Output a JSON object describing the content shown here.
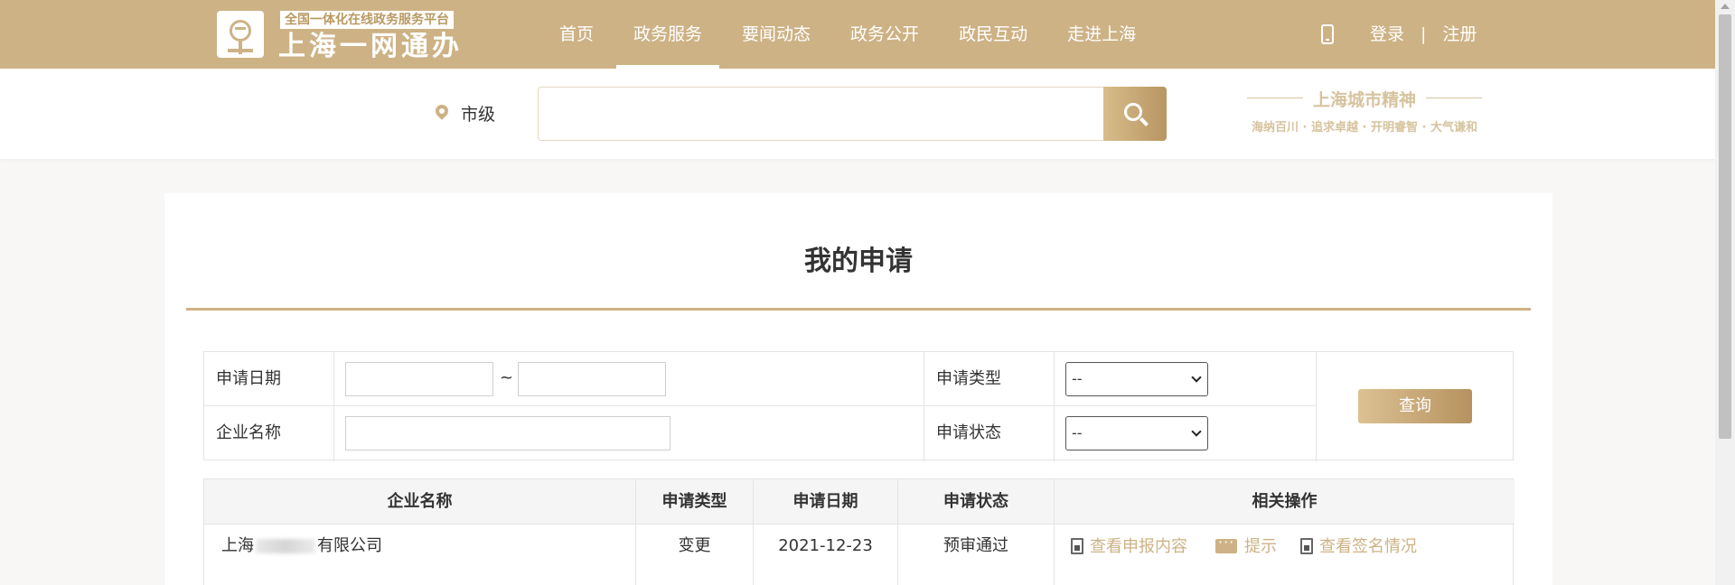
{
  "header": {
    "logo_tagline": "全国一体化在线政务服务平台",
    "logo_title": "上海一网通办",
    "nav": [
      {
        "label": "首页",
        "active": false
      },
      {
        "label": "政务服务",
        "active": true
      },
      {
        "label": "要闻动态",
        "active": false
      },
      {
        "label": "政务公开",
        "active": false
      },
      {
        "label": "政民互动",
        "active": false
      },
      {
        "label": "走进上海",
        "active": false
      }
    ],
    "login": "登录",
    "separator": "|",
    "register": "注册",
    "phone_icon": "mobile-phone-icon"
  },
  "search": {
    "location": "市级",
    "placeholder": "",
    "value": "",
    "location_icon": "map-pin-icon",
    "button_icon": "search-icon"
  },
  "spirit": {
    "title": "上海城市精神",
    "subtitle": "海纳百川 · 追求卓越 · 开明睿智 · 大气谦和"
  },
  "page": {
    "title": "我的申请"
  },
  "filter": {
    "date_label": "申请日期",
    "date_from": "",
    "date_to": "",
    "tilde": "~",
    "type_label": "申请类型",
    "type_value": "--",
    "company_label": "企业名称",
    "company_value": "",
    "status_label": "申请状态",
    "status_value": "--",
    "query_button": "查询"
  },
  "results": {
    "headers": [
      "企业名称",
      "申请类型",
      "申请日期",
      "申请状态",
      "相关操作"
    ],
    "rows": [
      {
        "company_prefix": "上海",
        "company_suffix": "有限公司",
        "type": "变更",
        "date": "2021-12-23",
        "status": "预审通过",
        "actions": [
          "查看申报内容",
          "提示",
          "查看签名情况"
        ]
      }
    ]
  },
  "colors": {
    "brand": "#cdb285",
    "brand_dark": "#b89562"
  }
}
